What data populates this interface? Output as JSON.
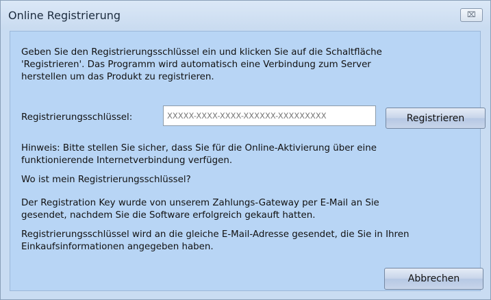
{
  "window": {
    "title": "Online Registrierung",
    "close_glyph": "⌧"
  },
  "content": {
    "intro_line1": "Geben Sie den Registrierungsschlüssel ein und klicken Sie auf die Schaltfläche",
    "intro_line2": "'Registrieren'. Das Programm wird automatisch eine Verbindung zum Server",
    "intro_line3": "herstellen um das Produkt zu registrieren.",
    "key_label": "Registrierungsschlüssel:",
    "key_value": "XXXXX-XXXX-XXXX-XXXXXX-XXXXXXXXX",
    "register_button": "Registrieren",
    "hint_line1": "Hinweis: Bitte stellen Sie sicher, dass Sie für die Online-Aktivierung über eine",
    "hint_line2": "funktionierende Internetverbindung verfügen.",
    "question": "Wo ist mein Registrierungsschlüssel?",
    "paragraph1_line1": "Der Registration Key wurde von unserem Zahlungs-Gateway per E-Mail an Sie",
    "paragraph1_line2": "gesendet, nachdem Sie die Software erfolgreich gekauft hatten.",
    "paragraph2_line1": "Registrierungsschlüssel wird an die gleiche E-Mail-Adresse gesendet, die Sie in Ihren",
    "paragraph2_line2": "Einkaufsinformationen angegeben haben.",
    "cancel_button": "Abbrechen"
  },
  "icons": {
    "close": "close-icon"
  },
  "colors": {
    "dialog_background": "#b8d5f5",
    "title_bar": "#d4e4f6",
    "button_face": "#c8d5ea"
  }
}
